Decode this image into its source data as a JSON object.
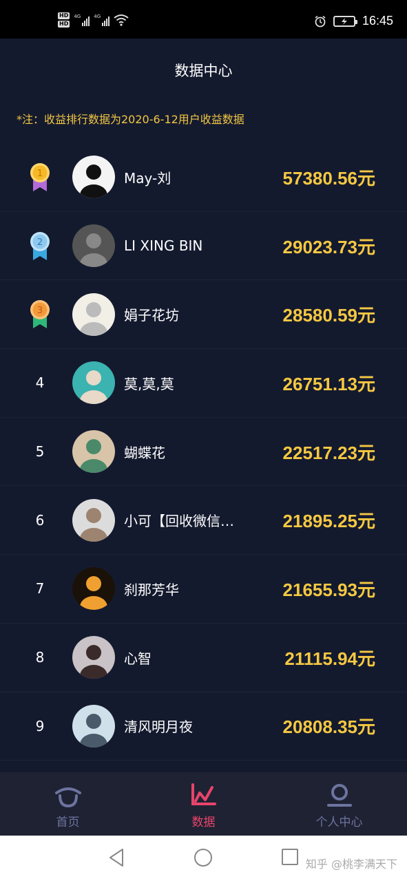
{
  "status_bar": {
    "hd1": "HD",
    "hd2": "HD",
    "sig1_label": "4G",
    "sig2_label": "4G",
    "time": "16:45"
  },
  "header": {
    "title": "数据中心"
  },
  "notice": "*注：收益排行数据为2020-6-12用户收益数据",
  "rankings": [
    {
      "rank": "1",
      "medal": "gold",
      "name": "May-刘",
      "amount": "57380.56元"
    },
    {
      "rank": "2",
      "medal": "silver",
      "name": "LI XING BIN",
      "amount": "29023.73元"
    },
    {
      "rank": "3",
      "medal": "bronze",
      "name": "娟子花坊",
      "amount": "28580.59元"
    },
    {
      "rank": "4",
      "name": "莫,莫,莫",
      "amount": "26751.13元"
    },
    {
      "rank": "5",
      "name": "蝴蝶花",
      "amount": "22517.23元"
    },
    {
      "rank": "6",
      "name": "小可【回收微信…",
      "amount": "21895.25元"
    },
    {
      "rank": "7",
      "name": "刹那芳华",
      "amount": "21655.93元"
    },
    {
      "rank": "8",
      "name": "心智",
      "amount": "21115.94元"
    },
    {
      "rank": "9",
      "name": "清风明月夜",
      "amount": "20808.35元"
    }
  ],
  "tabs": [
    {
      "label": "首页",
      "icon": "home-icon",
      "active": false
    },
    {
      "label": "数据",
      "icon": "chart-icon",
      "active": true
    },
    {
      "label": "个人中心",
      "icon": "profile-icon",
      "active": false
    }
  ],
  "watermark": "知乎 @桃李满天下",
  "colors": {
    "background": "#141a2e",
    "amount": "#f5c842",
    "notice": "#f2c744",
    "tab_active": "#e8446c",
    "tab_inactive": "#6d74a0"
  }
}
